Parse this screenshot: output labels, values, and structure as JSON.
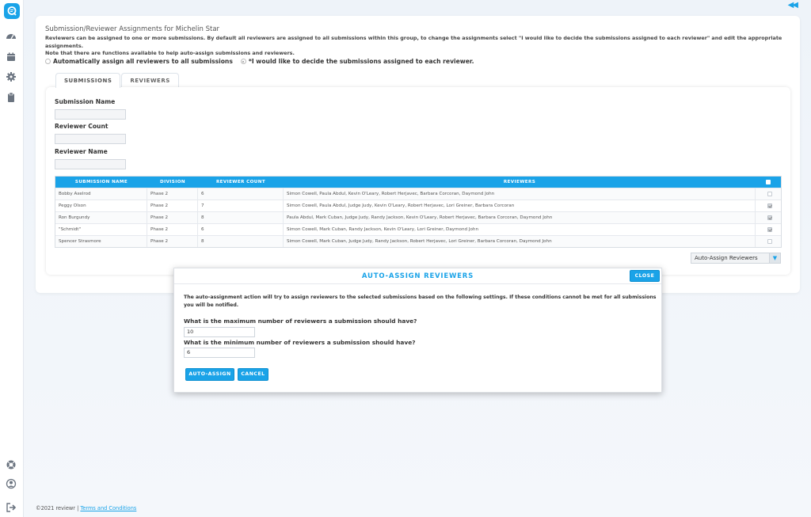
{
  "colors": {
    "accent": "#1aa3e8",
    "background": "#f1f5fa"
  },
  "sidebar": {
    "icons": [
      "logo-icon",
      "dashboard-icon",
      "calendar-icon",
      "gear-icon",
      "clipboard-icon",
      "help-icon",
      "user-icon",
      "logout-icon"
    ]
  },
  "header": {
    "collapse_glyph": "◀◀"
  },
  "page": {
    "title": "Submission/Reviewer Assignments for Michelin Star",
    "description_line1": "Reviewers can be assigned to one or more submissions. By default all reviewers are assigned to all submissions within this group, to change the assignments select \"I would like to decide the submissions assigned to each reviewer\" and edit the appropriate assignments.",
    "description_line2": "Note that there are functions available to help auto-assign submissions and reviewers."
  },
  "assignment_mode": {
    "option_auto": "Automatically assign all reviewers to all submissions",
    "option_manual": "*I would like to decide the submissions assigned to each reviewer.",
    "selected": "manual"
  },
  "tabs": [
    {
      "label": "SUBMISSIONS",
      "active": true
    },
    {
      "label": "REVIEWERS",
      "active": false
    }
  ],
  "filters": {
    "submission_name_label": "Submission Name",
    "reviewer_count_label": "Reviewer Count",
    "reviewer_name_label": "Reviewer Name"
  },
  "table": {
    "columns": [
      "SUBMISSION NAME",
      "DIVISION",
      "REVIEWER COUNT",
      "REVIEWERS"
    ],
    "rows": [
      {
        "name": "Bobby Axelrod",
        "division": "Phase 2",
        "count": "6",
        "reviewers": "Simon Cowell, Paula Abdul, Kevin O'Leary, Robert Herjavec, Barbara Corcoran, Daymond John",
        "checked": false
      },
      {
        "name": "Peggy Olson",
        "division": "Phase 2",
        "count": "7",
        "reviewers": "Simon Cowell, Paula Abdul, Judge Judy, Kevin O'Leary, Robert Herjavec, Lori Greiner, Barbara Corcoran",
        "checked": true
      },
      {
        "name": "Ron Burgundy",
        "division": "Phase 2",
        "count": "8",
        "reviewers": "Paula Abdul, Mark Cuban, Judge Judy, Randy Jackson, Kevin O'Leary, Robert Herjavec, Barbara Corcoran, Daymond John",
        "checked": true
      },
      {
        "name": "\"Schmidt\"",
        "division": "Phase 2",
        "count": "6",
        "reviewers": "Simon Cowell, Mark Cuban, Randy Jackson, Kevin O'Leary, Lori Greiner, Daymond John",
        "checked": true
      },
      {
        "name": "Spencer Strasmore",
        "division": "Phase 2",
        "count": "8",
        "reviewers": "Simon Cowell, Mark Cuban, Judge Judy, Randy Jackson, Robert Herjavec, Lori Greiner, Barbara Corcoran, Daymond John",
        "checked": false
      }
    ]
  },
  "actions": {
    "dropdown_label": "Auto-Assign Reviewers",
    "dropdown_arrow": "▼"
  },
  "modal": {
    "title": "AUTO-ASSIGN REVIEWERS",
    "close_label": "CLOSE",
    "description": "The auto-assignment action will try to assign reviewers to the selected submissions based on the following settings. If these conditions cannot be met for all submissions you will be notified.",
    "max_label": "What is the maximum number of reviewers a submission should have?",
    "max_value": "10",
    "min_label": "What is the minimum number of reviewers a submission should have?",
    "min_value": "6",
    "auto_assign_label": "AUTO-ASSIGN",
    "cancel_label": "CANCEL"
  },
  "footer": {
    "copyright": "©2021 reviewr | ",
    "terms_label": "Terms and Conditions"
  }
}
